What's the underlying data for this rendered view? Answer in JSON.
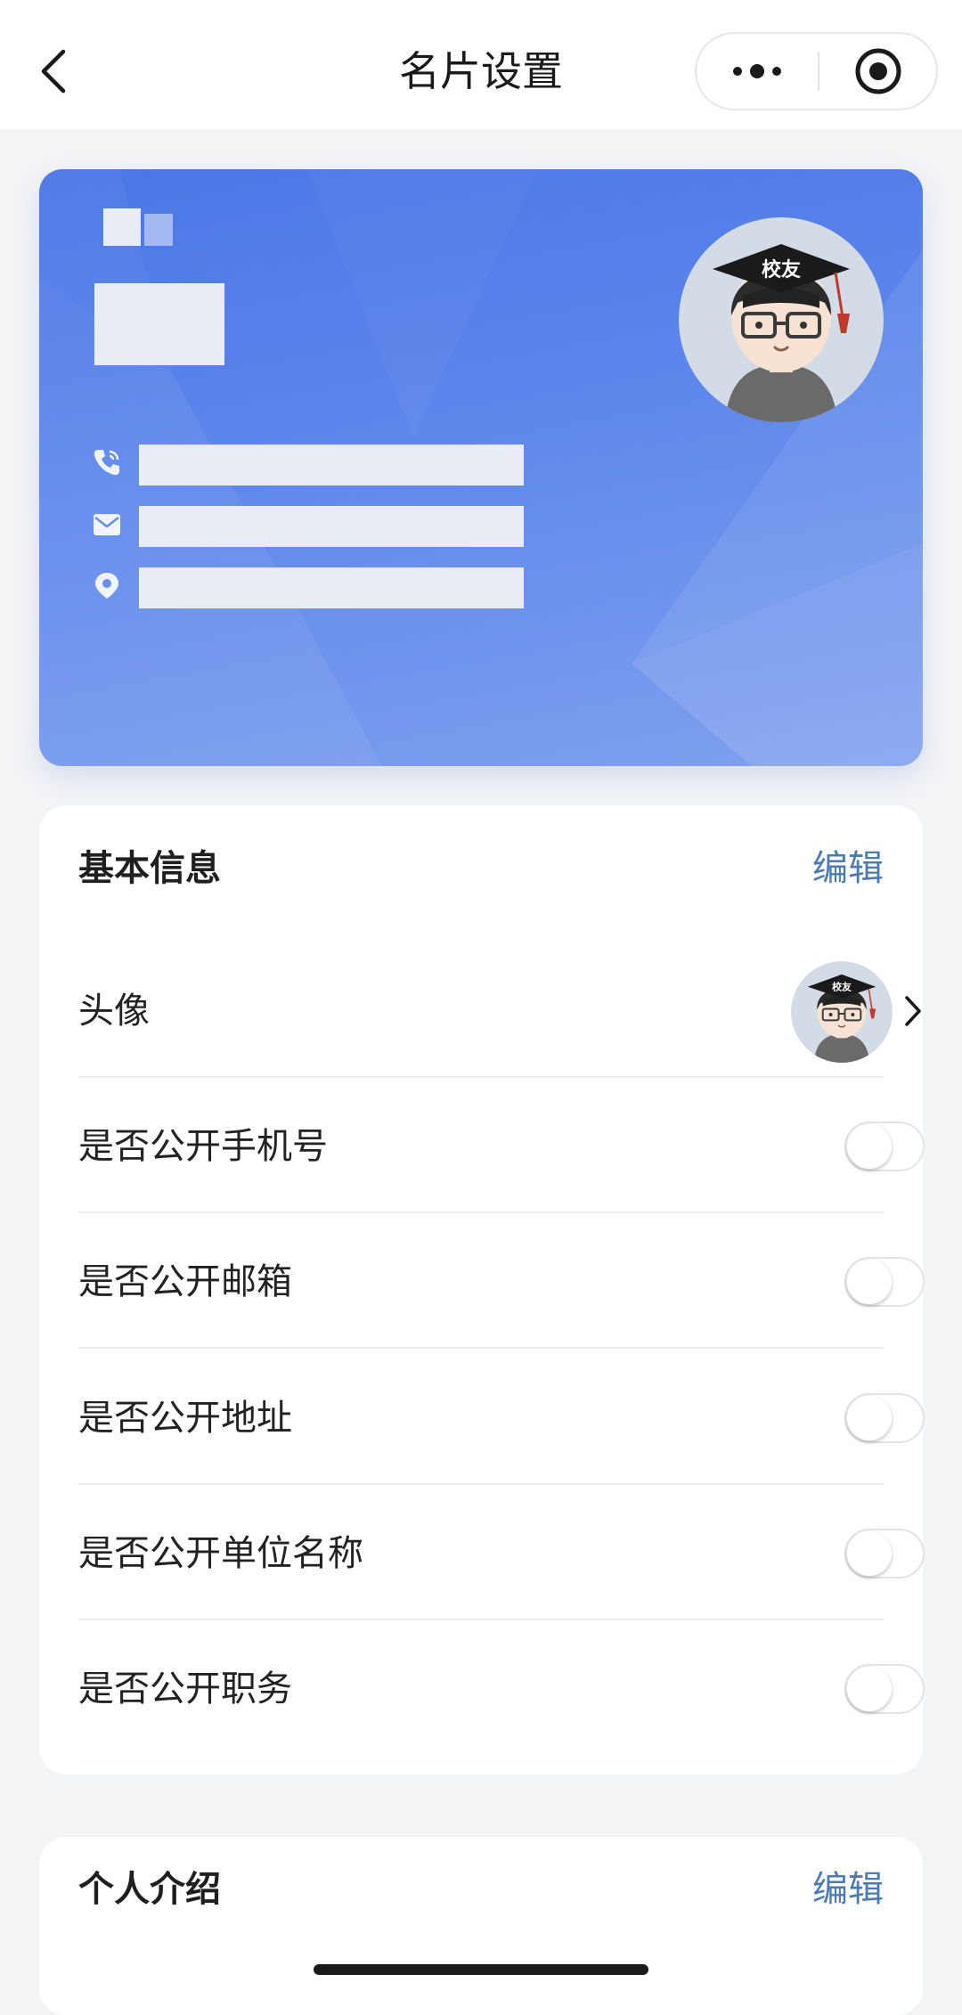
{
  "navbar": {
    "title": "名片设置",
    "back_icon": "chevron-left-icon",
    "more_icon": "more-dots-icon",
    "close_icon": "target-close-icon"
  },
  "card": {
    "background_color": "#5a84ea",
    "avatar_badge": "校友",
    "contact_icons": [
      "phone-icon",
      "mail-icon",
      "location-icon"
    ]
  },
  "basic_info": {
    "title": "基本信息",
    "edit_label": "编辑",
    "avatar_label": "头像",
    "toggles": [
      {
        "label": "是否公开手机号",
        "on": false
      },
      {
        "label": "是否公开邮箱",
        "on": false
      },
      {
        "label": "是否公开地址",
        "on": false
      },
      {
        "label": "是否公开单位名称",
        "on": false
      },
      {
        "label": "是否公开职务",
        "on": false
      }
    ]
  },
  "intro": {
    "title": "个人介绍",
    "edit_label": "编辑"
  },
  "colors": {
    "accent_link": "#4a7bb5",
    "card_blue": "#4a76e6",
    "page_bg": "#f3f4f6"
  }
}
